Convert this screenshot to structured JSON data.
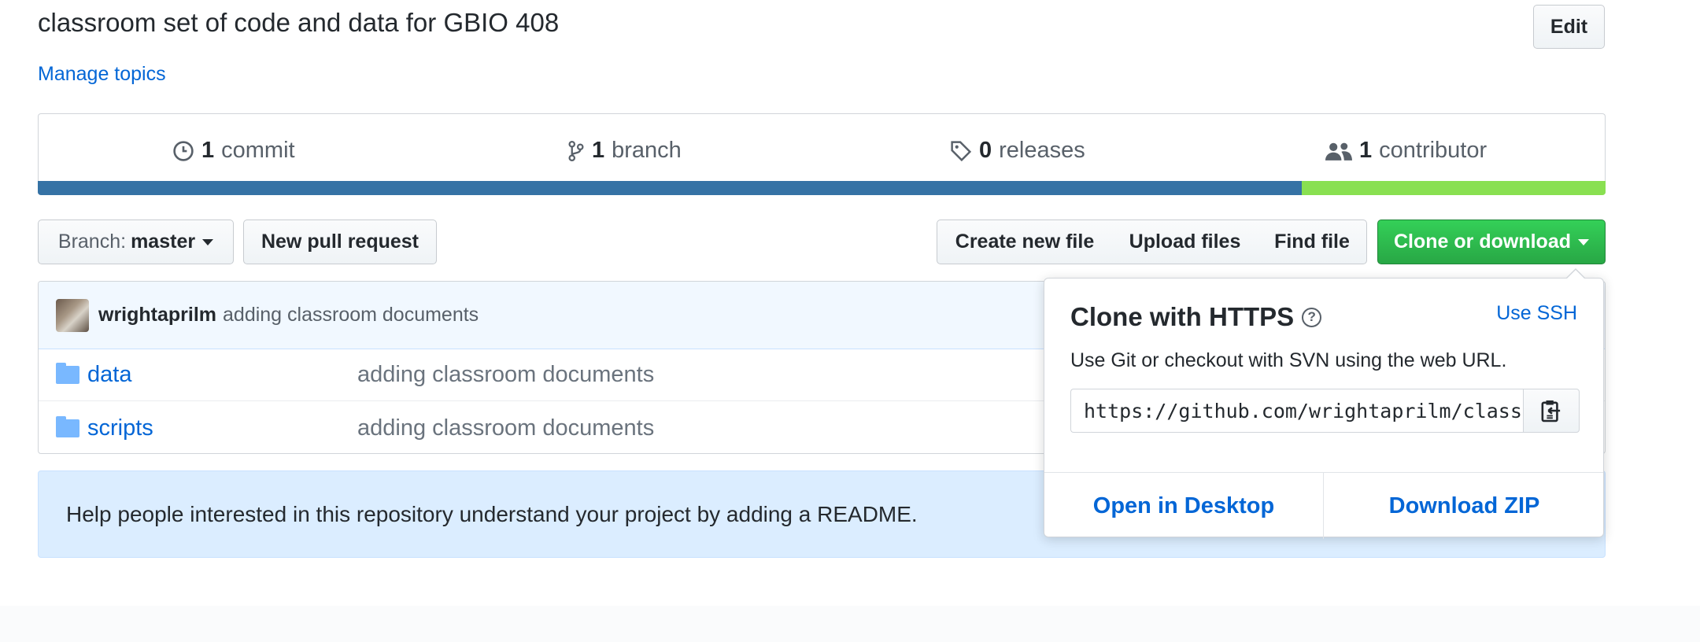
{
  "repo": {
    "description": "classroom set of code and data for GBIO 408",
    "edit_label": "Edit",
    "manage_topics": "Manage topics"
  },
  "stats": {
    "commits_count": "1",
    "commits_label": "commit",
    "branches_count": "1",
    "branches_label": "branch",
    "releases_count": "0",
    "releases_label": "releases",
    "contributors_count": "1",
    "contributors_label": "contributor"
  },
  "language_bar": {
    "segments": [
      {
        "color": "#3572a5",
        "fraction": 0.806
      },
      {
        "color": "#89e051",
        "fraction": 0.194
      }
    ]
  },
  "toolbar": {
    "branch_prefix": "Branch:",
    "branch_name": "master",
    "new_pull_request": "New pull request",
    "create_new_file": "Create new file",
    "upload_files": "Upload files",
    "find_file": "Find file",
    "clone_or_download": "Clone or download"
  },
  "latest_commit": {
    "author": "wrightaprilm",
    "message": "adding classroom documents"
  },
  "files": [
    {
      "name": "data",
      "icon": "folder-icon",
      "message": "adding classroom documents"
    },
    {
      "name": "scripts",
      "icon": "folder-icon",
      "message": "adding classroom documents"
    }
  ],
  "readme_prompt": "Help people interested in this repository understand your project by adding a README.",
  "clone_popover": {
    "title": "Clone with HTTPS",
    "use_ssh": "Use SSH",
    "subtitle": "Use Git or checkout with SVN using the web URL.",
    "url": "https://github.com/wrightaprilm/class",
    "open_in_desktop": "Open in Desktop",
    "download_zip": "Download ZIP"
  }
}
